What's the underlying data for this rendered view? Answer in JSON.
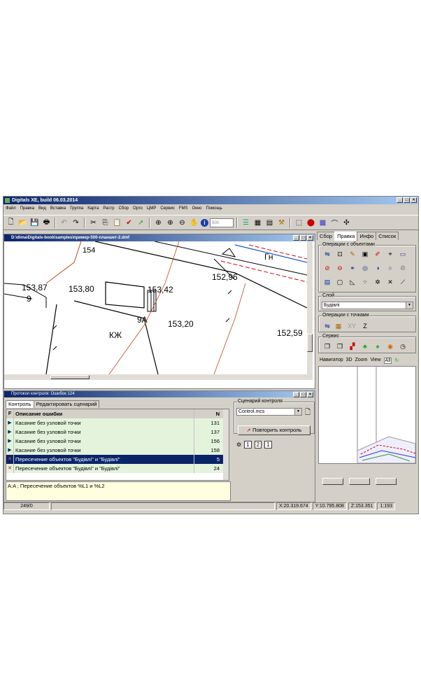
{
  "window": {
    "title": "Digitals XE, build 06.03.2014",
    "controls": [
      "_",
      "□",
      "×"
    ]
  },
  "menu": [
    "Файл",
    "Правка",
    "Вид",
    "Вставка",
    "Группа",
    "Карта",
    "Растр",
    "Сбор",
    "Орто",
    "ЦМР",
    "Сервис",
    "FMS",
    "Окно",
    "Помощь"
  ],
  "toolbar": {
    "scale_value": "500"
  },
  "map_window": {
    "title": "D:\\dima\\Digitals-book\\samples\\пример-500-планшет-2.dmf",
    "labels": {
      "l1": "153,87",
      "l2": "9",
      "l3": "153,80",
      "l4": "153,42",
      "l5": "152,96",
      "l6": "Гн",
      "l7": "9А",
      "l8": "153,20",
      "l9": "152,59",
      "l10": "КЖ",
      "l11": "154"
    }
  },
  "right_panel": {
    "tabs": [
      "Сбор",
      "Правка",
      "Инфо",
      "Список"
    ],
    "active_tab": "Правка",
    "ops_objects_label": "Операции с объектами",
    "layer_label": "Слой",
    "layer_value": "Будівлі",
    "ops_points_label": "Операции с точками",
    "service_label": "Сервис",
    "points_xyz": [
      "X",
      "Y",
      "Z"
    ],
    "nav_tabs": [
      "Навигатор",
      "3D",
      "Zoom",
      "View",
      "All"
    ]
  },
  "error_window": {
    "title": "Протокол контроля: Ошибок 124",
    "tabs": [
      "Контроль",
      "Редактировать сценарий"
    ],
    "header_f": "F",
    "header_desc": "Описание ошибки",
    "header_n": "N",
    "rows": [
      {
        "flag": "▶",
        "desc": "Касание без узловой точки",
        "n": "131"
      },
      {
        "flag": "▶",
        "desc": "Касание без узловой точки",
        "n": "137"
      },
      {
        "flag": "▶",
        "desc": "Касание без узловой точки",
        "n": "156"
      },
      {
        "flag": "▶",
        "desc": "Касание без узловой точки",
        "n": "158"
      },
      {
        "flag": "✕",
        "desc": "Пересечение объектов \"Будівлі\" и \"Будівлі\"",
        "n": "5"
      },
      {
        "flag": "✕",
        "desc": "Пересечение объектов \"Будівлі\" и \"Будівлі\"",
        "n": "24"
      }
    ],
    "description": "A:A ; Пересечение объектов %L1 и %L2",
    "scenario_label": "Сценарий контроля",
    "scenario_file": "Control.mcs",
    "repeat_button": "Повторить контроль",
    "steps": [
      "1",
      "2",
      "1"
    ]
  },
  "statusbar": {
    "counter": "249/0",
    "x": "X:20.319.674",
    "y": "Y:10.795.808",
    "z": "Z:153.351",
    "scale": "1:193"
  },
  "colors": {
    "titlebar": "#0a246a",
    "selected_row": "#0a246a",
    "light_row": "#e4f4dc",
    "desc_bg": "#ffffe0"
  }
}
